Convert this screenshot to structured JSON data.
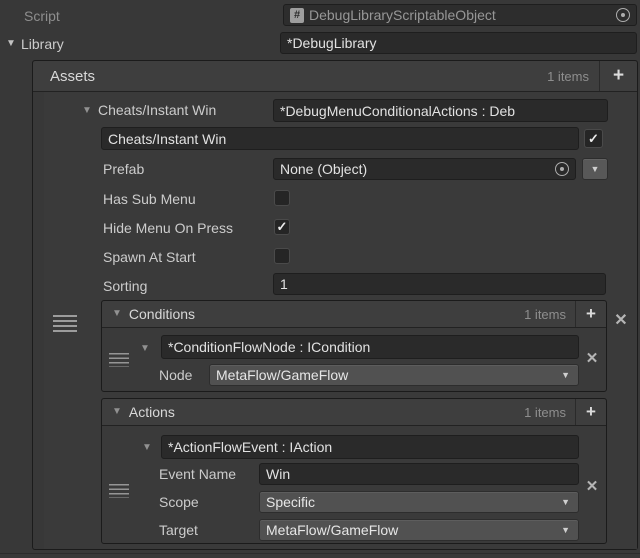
{
  "glyphs": {
    "foldout": "▼",
    "dropdown": "▼",
    "add": "+",
    "remove": "✕",
    "check": "✓",
    "hash": "#"
  },
  "colors": {
    "window_bg": "#383838",
    "header_bg": "#3e3e3e",
    "field_bg": "#2a2a2a",
    "element_bg": "#3a3a3a",
    "dropdown_bg": "#515151",
    "border": "#1b1b1b",
    "text": "#cccccc",
    "text_dim": "#8e8e8e",
    "text_bright": "#e2e2e2"
  },
  "script_row": {
    "label": "Script",
    "value": "DebugLibraryScriptableObject"
  },
  "library_row": {
    "label": "Library",
    "value": "*DebugLibrary"
  },
  "assets": {
    "title": "Assets",
    "count": "1 items",
    "element": {
      "foldout_label": "Cheats/Instant Win",
      "type_value": "*DebugMenuConditionalActions : Deb",
      "name_value": "Cheats/Instant Win",
      "enabled": true,
      "prefab": {
        "label": "Prefab",
        "value": "None (Object)"
      },
      "has_sub_menu": {
        "label": "Has Sub Menu",
        "checked": false
      },
      "hide_menu_on_press": {
        "label": "Hide Menu On Press",
        "checked": true
      },
      "spawn_at_start": {
        "label": "Spawn At Start",
        "checked": false
      },
      "sorting": {
        "label": "Sorting",
        "value": "1"
      },
      "conditions": {
        "title": "Conditions",
        "count": "1 items",
        "item": {
          "type_value": "*ConditionFlowNode : ICondition",
          "node": {
            "label": "Node",
            "value": "MetaFlow/GameFlow"
          }
        }
      },
      "actions": {
        "title": "Actions",
        "count": "1 items",
        "item": {
          "type_value": "*ActionFlowEvent : IAction",
          "event_name": {
            "label": "Event Name",
            "value": "Win"
          },
          "scope": {
            "label": "Scope",
            "value": "Specific"
          },
          "target": {
            "label": "Target",
            "value": "MetaFlow/GameFlow"
          }
        }
      }
    }
  }
}
